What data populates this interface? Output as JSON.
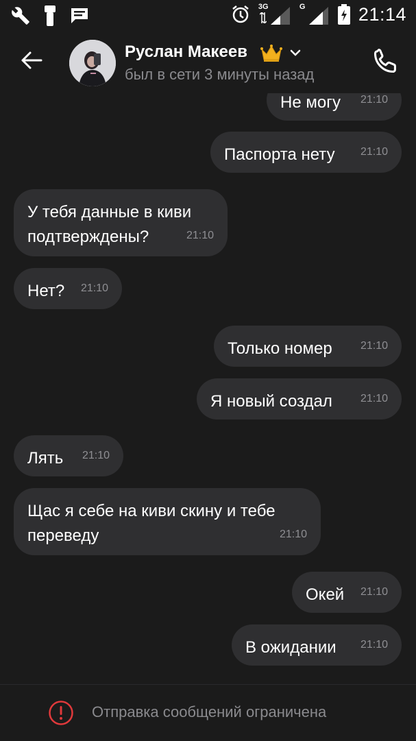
{
  "status_bar": {
    "time": "21:14",
    "left_icons": [
      "wrench-icon",
      "usb-icon",
      "message-icon"
    ],
    "right_icons": [
      "alarm-icon",
      "signal-3g-icon",
      "signal-g-icon",
      "battery-icon"
    ],
    "net_3g": "3G",
    "net_g": "G"
  },
  "header": {
    "name": "Руслан Макеев",
    "status": "был в сети 3 минуты назад"
  },
  "messages": [
    {
      "side": "out",
      "text": "Не могу",
      "time": "21:10"
    },
    {
      "side": "out",
      "text": "Паспорта нету",
      "time": "21:10"
    },
    {
      "side": "in",
      "text": "У тебя данные в киви подтверждены?",
      "time": "21:10"
    },
    {
      "side": "in",
      "text": "Нет?",
      "time": "21:10"
    },
    {
      "side": "out",
      "text": "Только номер",
      "time": "21:10"
    },
    {
      "side": "out",
      "text": "Я новый создал",
      "time": "21:10"
    },
    {
      "side": "in",
      "text": "Лять",
      "time": "21:10"
    },
    {
      "side": "in",
      "text": "Щас я себе на киви скину и тебе переведу",
      "time": "21:10"
    },
    {
      "side": "out",
      "text": "Окей",
      "time": "21:10"
    },
    {
      "side": "out",
      "text": "В ожидании",
      "time": "21:10"
    }
  ],
  "footer": {
    "text": "Отправка сообщений ограничена"
  },
  "colors": {
    "background": "#1b1b1b",
    "bubble": "#2f2f31",
    "secondary_text": "#8a8a8e",
    "warning": "#e0393b",
    "crown": "#f2b01e"
  }
}
